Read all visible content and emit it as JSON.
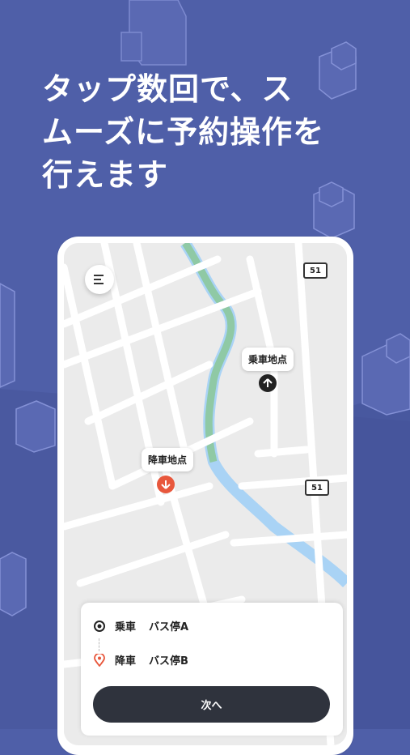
{
  "colors": {
    "background": "#4f5fa8",
    "pickup_pin": "#222222",
    "dropoff_pin": "#e8573c",
    "button": "#2f333d"
  },
  "headline": {
    "line1": "タップ数回で、ス",
    "line2": "ムーズに予約操作を",
    "line3": "行えます"
  },
  "map": {
    "route_badge_1": "51",
    "route_badge_2": "51",
    "pickup_label": "乗車地点",
    "dropoff_label": "降車地点",
    "menu_icon": "menu-icon"
  },
  "sheet": {
    "pickup_label": "乗車",
    "pickup_value": "バス停A",
    "dropoff_label": "降車",
    "dropoff_value": "バス停B",
    "next_button": "次へ"
  }
}
